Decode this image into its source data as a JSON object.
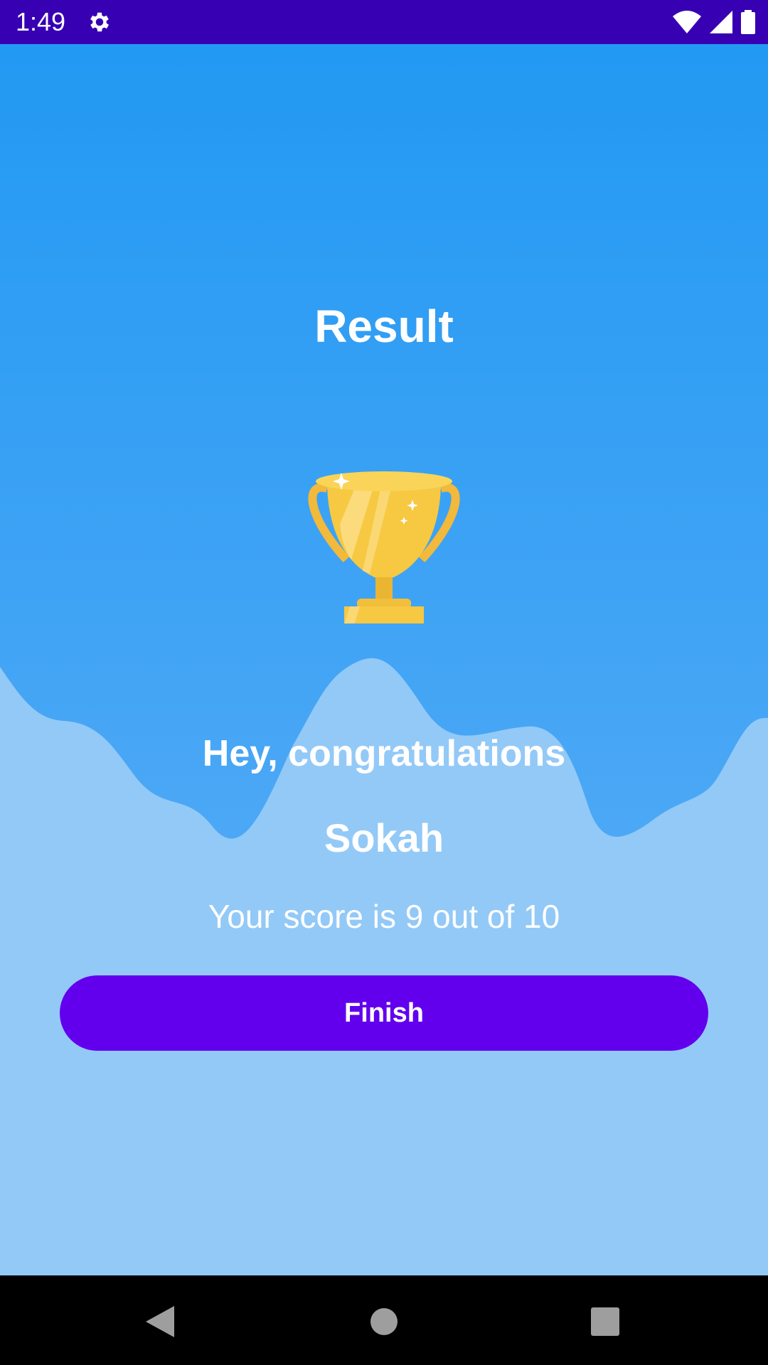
{
  "status_bar": {
    "time": "1:49",
    "icons": [
      "gear-icon",
      "wifi-icon",
      "cellular-icon",
      "battery-icon"
    ]
  },
  "result": {
    "title": "Result",
    "congrats": "Hey, congratulations",
    "name": "Sokah",
    "score_text": "Your score is 9 out of 10",
    "finish_label": "Finish",
    "trophy_icon": "trophy-icon"
  },
  "nav_bar": {
    "icons": [
      "back-icon",
      "home-icon",
      "recents-icon"
    ]
  },
  "colors": {
    "status_bar": "#3700b3",
    "background_top": "#2299f3",
    "wave_light": "#93c9f7",
    "finish_button": "#6200ee",
    "trophy_gold": "#f7c842"
  }
}
